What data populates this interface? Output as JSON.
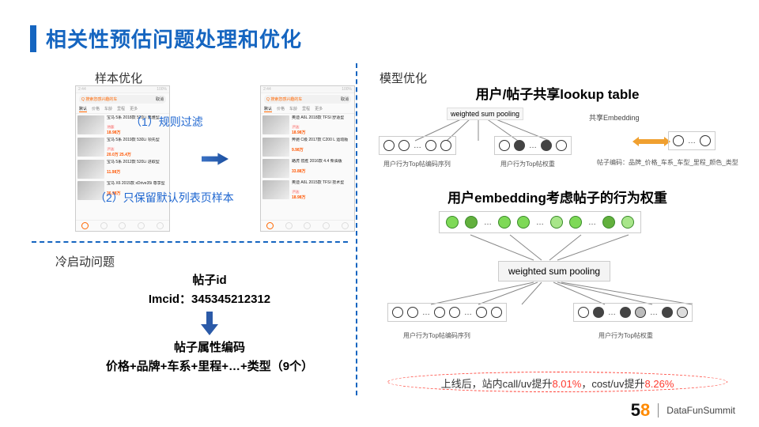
{
  "title": "相关性预估问题处理和优化",
  "sections": {
    "sample_opt": "样本优化",
    "cold_start": "冷启动问题",
    "model_opt": "模型优化"
  },
  "annotations": {
    "rule_filter": "（1）规则过滤",
    "keep_default": "（2）只保留默认列表页样本"
  },
  "phone": {
    "status_left": "2:44",
    "status_right": "100%",
    "search_text": "Q 搜索您感兴趣的车",
    "cancel": "取消",
    "tabs": [
      "默认",
      "价格",
      "车龄",
      "里程",
      "更多"
    ],
    "rows_left": [
      {
        "title": "宝马 5系 2018款 520Li 典雅型",
        "tag": "特惠",
        "price": "18.98万"
      },
      {
        "title": "宝马 5系 2019款 530Li 领先型",
        "tag": "严选",
        "price": "20.0万  25.4万"
      },
      {
        "title": "宝马 5系 2012款 520Li 进取型",
        "tag": "",
        "price": "11.98万"
      },
      {
        "title": "宝马 X6 2015款 xDrive35i 尊享型",
        "tag": "",
        "price": "36.98万"
      }
    ],
    "rows_right": [
      {
        "title": "奥迪 A6L 2018款 TFSI 舒适型",
        "tag": "严选",
        "price": "18.98万"
      },
      {
        "title": "奔驰 C级 2017款 C200 L 运动版",
        "tag": "",
        "price": "9.98万"
      },
      {
        "title": "路虎 揽胜 2016款 4.4 柴油版",
        "tag": "",
        "price": "33.88万"
      },
      {
        "title": "奥迪 A6L 2015款 TFSI 技术型",
        "tag": "严选",
        "price": "18.98万"
      }
    ]
  },
  "cold": {
    "post_id_label": "帖子id",
    "imcid": "Imcid：345345212312",
    "attr_label": "帖子属性编码",
    "attr_value": "价格+品牌+车系+里程+…+类型（9个）"
  },
  "right": {
    "h1": "用户/帖子共享lookup table",
    "wsp": "weighted sum pooling",
    "share_emb": "共享Embedding",
    "cap_seq": "用户行为Top帖编码序列",
    "cap_weight": "用户行为Top帖权重",
    "cap_post_enc": "帖子编码：品牌_价格_车系_车型_里程_颜色_类型",
    "h2": "用户embedding考虑帖子的行为权重"
  },
  "result": {
    "prefix": "上线后，站内call/uv提升",
    "v1": "8.01%",
    "mid": "，cost/uv提升",
    "v2": "8.26%"
  },
  "footer": {
    "brand_5": "5",
    "brand_8": "8",
    "summit": "DataFunSummit"
  }
}
